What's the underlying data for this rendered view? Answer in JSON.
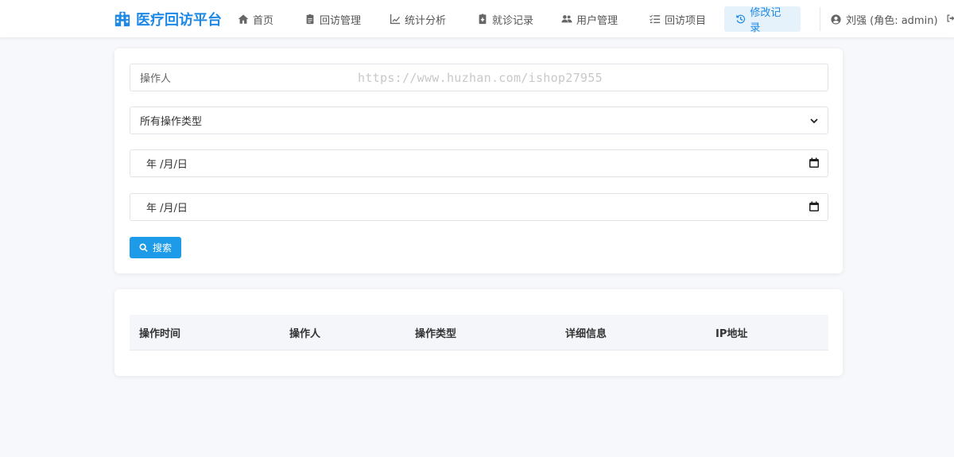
{
  "app": {
    "title": "医疗回访平台",
    "brand_color": "#1e88e5"
  },
  "nav": {
    "items": [
      {
        "label": "首页",
        "icon": "home-icon"
      },
      {
        "label": "回访管理",
        "icon": "clipboard-icon"
      },
      {
        "label": "统计分析",
        "icon": "chart-line-icon"
      },
      {
        "label": "就诊记录",
        "icon": "medical-file-icon"
      },
      {
        "label": "用户管理",
        "icon": "users-cog-icon"
      },
      {
        "label": "回访项目",
        "icon": "tasks-icon"
      },
      {
        "label": "修改记录",
        "icon": "history-icon",
        "active": true
      }
    ],
    "user": "刘强 (角色: admin)"
  },
  "filter": {
    "operator_placeholder": "操作人",
    "type_select_value": "所有操作类型",
    "start_date_placeholder": "年 /月/日",
    "end_date_placeholder": "年 /月/日",
    "search_label": "搜索",
    "watermark": "https://www.huzhan.com/ishop27955"
  },
  "table": {
    "columns": [
      "操作时间",
      "操作人",
      "操作类型",
      "详细信息",
      "IP地址"
    ],
    "rows": []
  }
}
